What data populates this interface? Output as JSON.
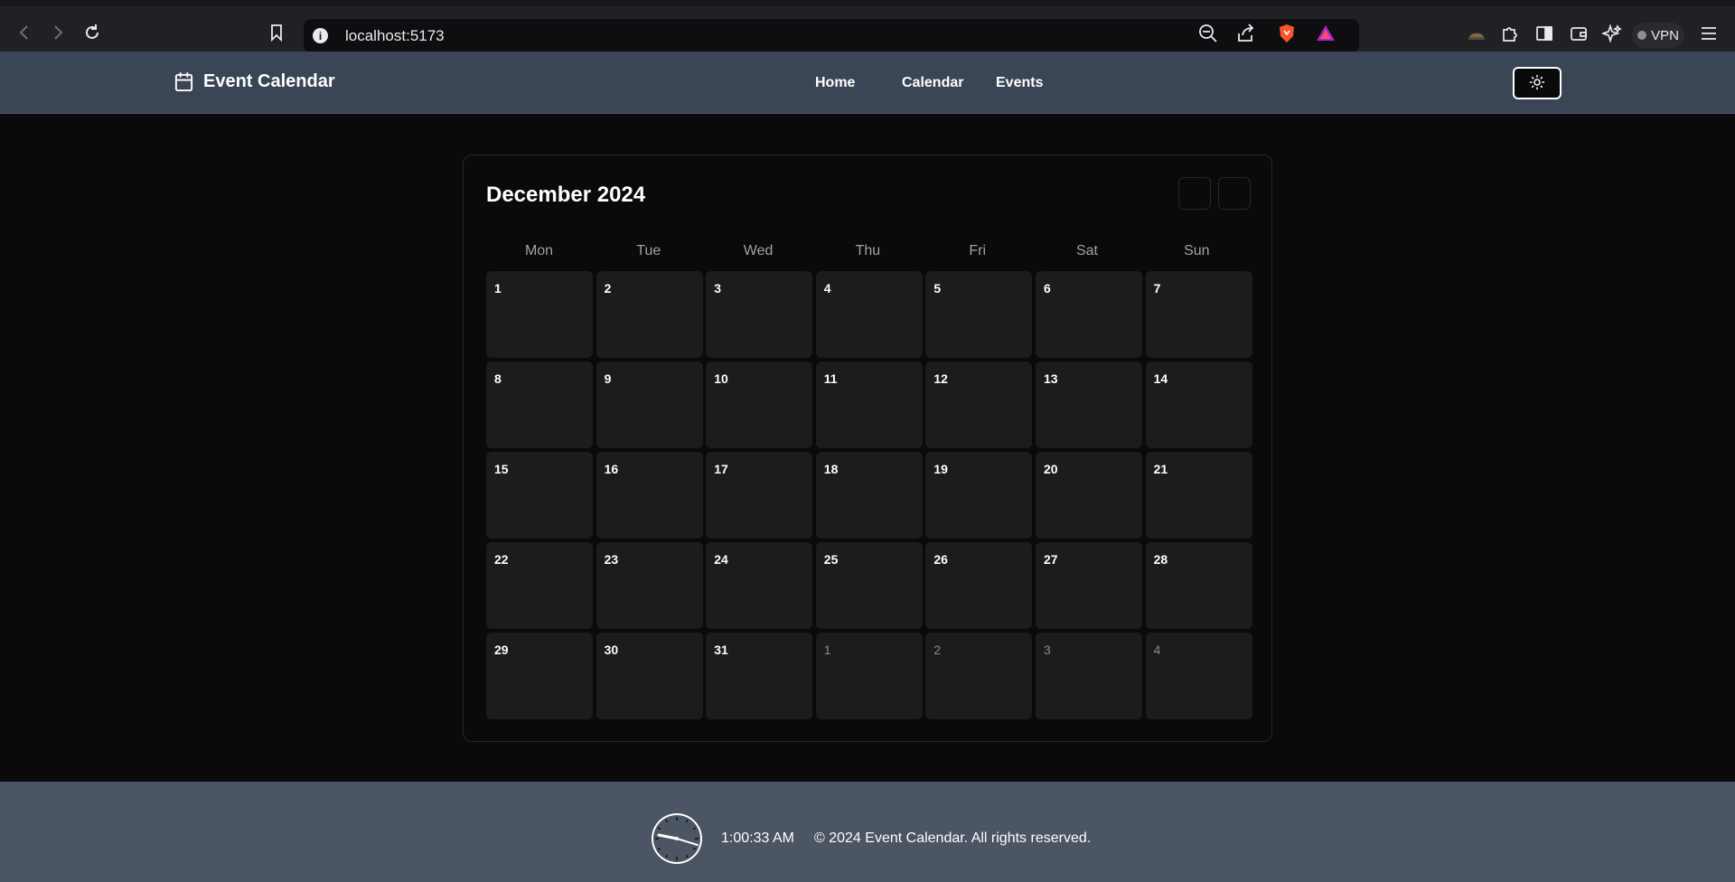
{
  "browser": {
    "url": "localhost:5173",
    "vpn_label": "VPN"
  },
  "header": {
    "brand": "Event Calendar",
    "nav": [
      "Home",
      "Calendar",
      "Events"
    ],
    "theme_icon": "sun-icon"
  },
  "calendar": {
    "month_title": "December 2024",
    "weekdays": [
      "Mon",
      "Tue",
      "Wed",
      "Thu",
      "Fri",
      "Sat",
      "Sun"
    ],
    "days": [
      {
        "n": "1",
        "current": true
      },
      {
        "n": "2",
        "current": true
      },
      {
        "n": "3",
        "current": true
      },
      {
        "n": "4",
        "current": true
      },
      {
        "n": "5",
        "current": true
      },
      {
        "n": "6",
        "current": true
      },
      {
        "n": "7",
        "current": true
      },
      {
        "n": "8",
        "current": true
      },
      {
        "n": "9",
        "current": true
      },
      {
        "n": "10",
        "current": true
      },
      {
        "n": "11",
        "current": true
      },
      {
        "n": "12",
        "current": true
      },
      {
        "n": "13",
        "current": true
      },
      {
        "n": "14",
        "current": true
      },
      {
        "n": "15",
        "current": true
      },
      {
        "n": "16",
        "current": true
      },
      {
        "n": "17",
        "current": true
      },
      {
        "n": "18",
        "current": true
      },
      {
        "n": "19",
        "current": true
      },
      {
        "n": "20",
        "current": true
      },
      {
        "n": "21",
        "current": true
      },
      {
        "n": "22",
        "current": true
      },
      {
        "n": "23",
        "current": true
      },
      {
        "n": "24",
        "current": true
      },
      {
        "n": "25",
        "current": true
      },
      {
        "n": "26",
        "current": true
      },
      {
        "n": "27",
        "current": true
      },
      {
        "n": "28",
        "current": true
      },
      {
        "n": "29",
        "current": true
      },
      {
        "n": "30",
        "current": true
      },
      {
        "n": "31",
        "current": true
      },
      {
        "n": "1",
        "current": false
      },
      {
        "n": "2",
        "current": false
      },
      {
        "n": "3",
        "current": false
      },
      {
        "n": "4",
        "current": false
      }
    ]
  },
  "footer": {
    "time": "1:00:33 AM",
    "copyright": "© 2024 Event Calendar. All rights reserved."
  },
  "colors": {
    "header_bg": "#3a4555",
    "footer_bg": "#4b5563",
    "page_bg": "#0a0a0a",
    "cell_bg": "#1c1c1c"
  }
}
